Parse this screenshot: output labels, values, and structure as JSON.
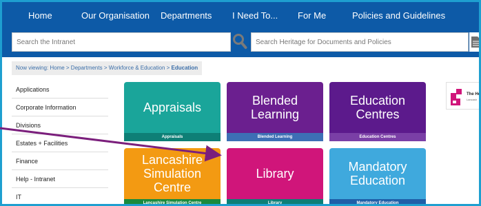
{
  "nav": {
    "items": [
      "Home",
      "Our Organisation",
      "Departments",
      "I Need To...",
      "For Me",
      "Policies and Guidelines"
    ]
  },
  "search": {
    "intranet_placeholder": "Search the Intranet",
    "heritage_placeholder": "Search Heritage for Documents and Policies"
  },
  "breadcrumb": {
    "prefix": "Now viewing: Home > Departments > Workforce & Education > ",
    "current": "Education"
  },
  "sidebar": {
    "items": [
      "Applications",
      "Corporate Information",
      "Divisions",
      "Estates + Facilities",
      "Finance",
      "Help - Intranet",
      "IT"
    ]
  },
  "tiles": [
    {
      "title": "Appraisals",
      "caption": "Appraisals",
      "color": "#1aa59a",
      "caption_color": "#0e7f76"
    },
    {
      "title": "Blended\nLearning",
      "caption": "Blended Learning",
      "color": "#6b1f8f",
      "caption_color": "#3d6fb5"
    },
    {
      "title": "Education\nCentres",
      "caption": "Education Centres",
      "color": "#5c1a8c",
      "caption_color": "#7a3fa6"
    },
    {
      "title": "Lancashire\nSimulation\nCentre",
      "caption": "Lancashire Simulation Centre",
      "color": "#f39a12",
      "caption_color": "#1a8a3c"
    },
    {
      "title": "Library",
      "caption": "Library",
      "color": "#d0157a",
      "caption_color": "#0e7f76"
    },
    {
      "title": "Mandatory\nEducation",
      "caption": "Mandatory Education",
      "color": "#3fa9dd",
      "caption_color": "#1f5fa8"
    }
  ],
  "logo": {
    "text": "The He",
    "subtext": "Lancash"
  },
  "colors": {
    "nav_bg": "#0d5aa7",
    "frame_border": "#1e9fd0",
    "arrow": "#7b1f7c"
  },
  "icons": {
    "search": "magnifier-icon",
    "document": "document-icon",
    "arrow": "arrow-annotation"
  }
}
